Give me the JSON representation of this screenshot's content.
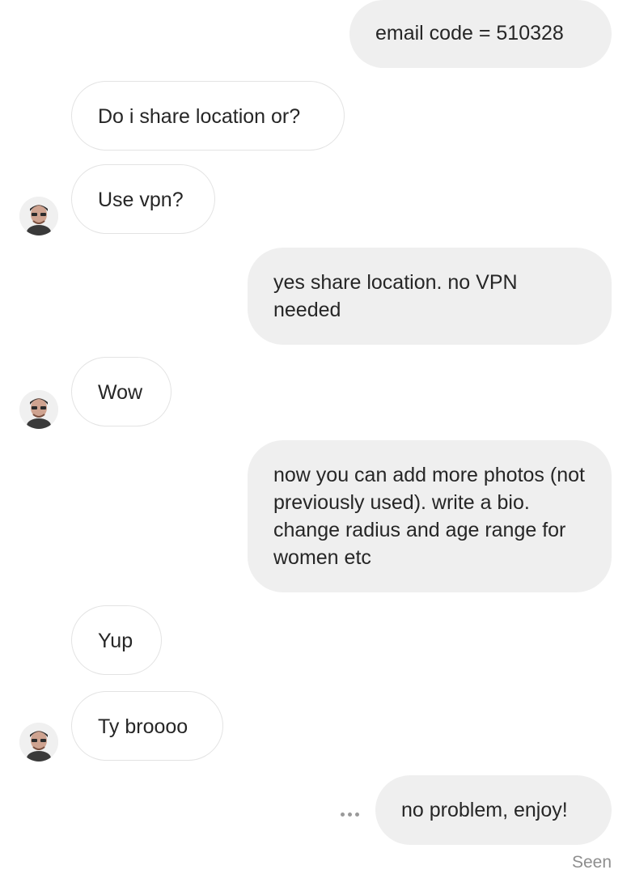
{
  "thread": {
    "messages": [
      {
        "from": "me",
        "text": "email code = 510328"
      },
      {
        "from": "them",
        "text": "Do i share location or?"
      },
      {
        "from": "them",
        "text": "Use vpn?"
      },
      {
        "from": "me",
        "text": "yes share location. no VPN needed"
      },
      {
        "from": "them",
        "text": "Wow"
      },
      {
        "from": "me",
        "text": "now you can add more photos (not previously used). write a bio. change radius and age range for women etc"
      },
      {
        "from": "them",
        "text": "Yup"
      },
      {
        "from": "them",
        "text": "Ty broooo"
      },
      {
        "from": "me",
        "text": "no problem, enjoy!"
      }
    ],
    "status": "Seen",
    "icons": {
      "avatar": "avatar-icon",
      "options": "more-options-icon"
    }
  }
}
